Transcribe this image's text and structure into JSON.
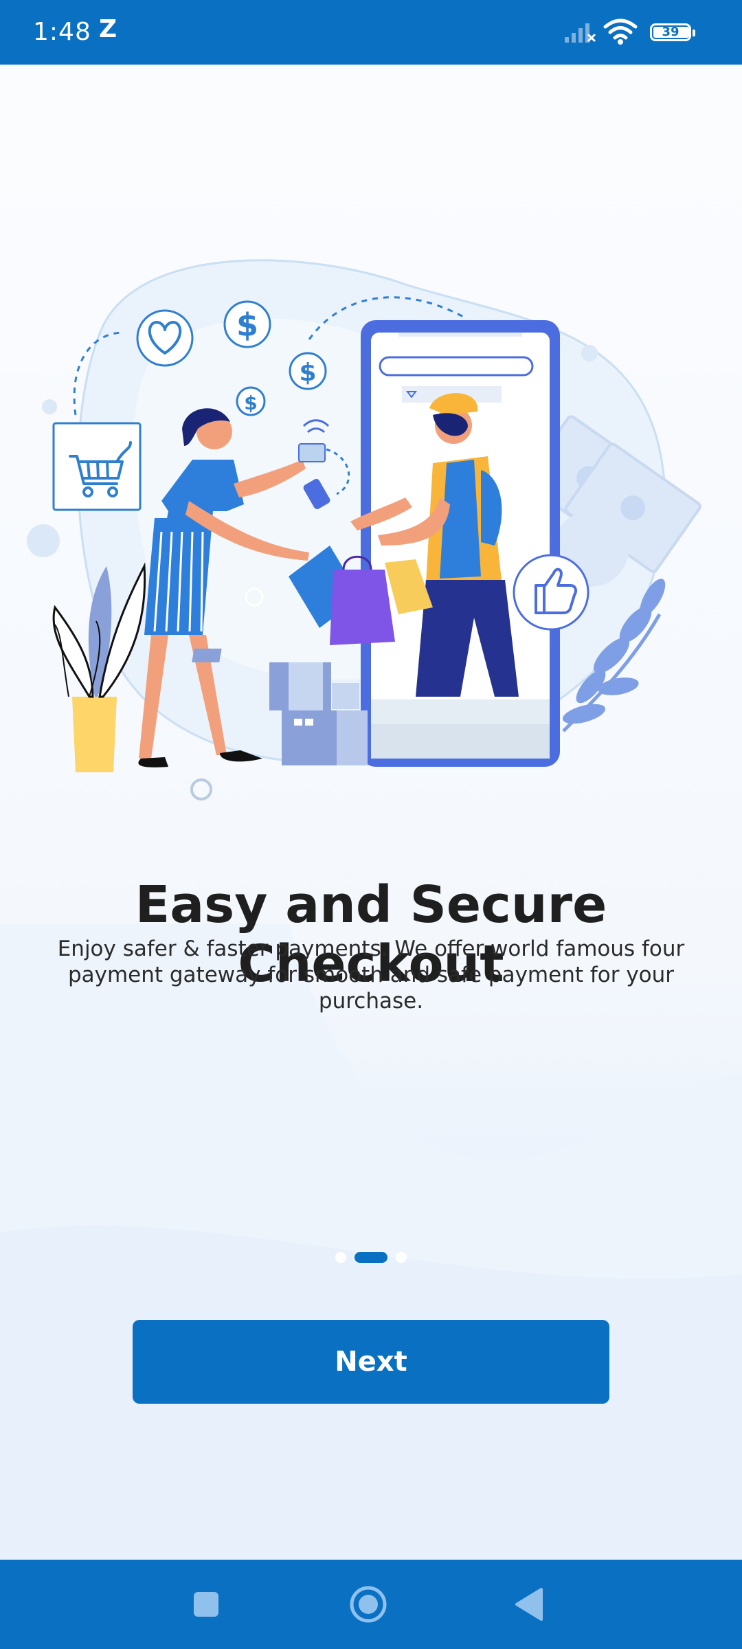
{
  "status_bar": {
    "time": "1:48",
    "app_indicator": "Z",
    "battery_level": "39",
    "icons": [
      "signal-icon",
      "wifi-icon",
      "battery-icon"
    ]
  },
  "onboarding": {
    "illustration": "checkout-illustration",
    "title": "Easy and Secure Checkout",
    "description": "Enjoy safer & faster payments. We offer world famous four payment gateway for smooth and safe payment for your purchase.",
    "page_indicator": {
      "total": 3,
      "current": 2
    },
    "next_label": "Next"
  },
  "nav_bar": {
    "buttons": [
      "recent-apps-icon",
      "home-icon",
      "back-icon"
    ]
  },
  "colors": {
    "primary": "#0a70c2",
    "title_text": "#1f1f1f",
    "body_text": "#2a2a2a",
    "background": "#f4f8fd"
  }
}
